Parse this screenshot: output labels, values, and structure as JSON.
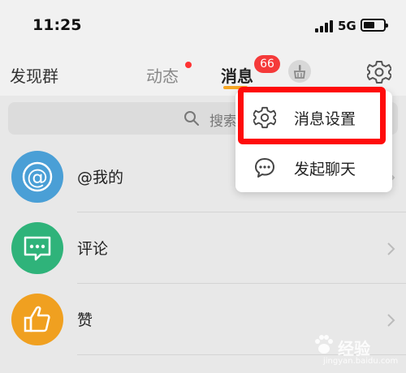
{
  "status_bar": {
    "time": "11:25",
    "network": "5G"
  },
  "nav": {
    "discover_label": "发现群",
    "feed_label": "动态",
    "messages_label": "消息",
    "messages_badge": "66",
    "accent_color": "#f5a623",
    "badge_color": "#f53a3a"
  },
  "search": {
    "placeholder": "搜索"
  },
  "list": {
    "items": [
      {
        "label": "@我的",
        "icon": "at-icon",
        "color": "#4a9fd6"
      },
      {
        "label": "评论",
        "icon": "comment-icon",
        "color": "#2fb37a"
      },
      {
        "label": "赞",
        "icon": "thumbs-up-icon",
        "color": "#f0a020"
      }
    ]
  },
  "popup": {
    "items": [
      {
        "label": "消息设置",
        "icon": "gear-icon"
      },
      {
        "label": "发起聊天",
        "icon": "chat-bubble-icon"
      }
    ],
    "highlight_color": "#ff0b0b"
  },
  "watermark": {
    "text": "经验",
    "url": "jingyan.baidu.com"
  }
}
